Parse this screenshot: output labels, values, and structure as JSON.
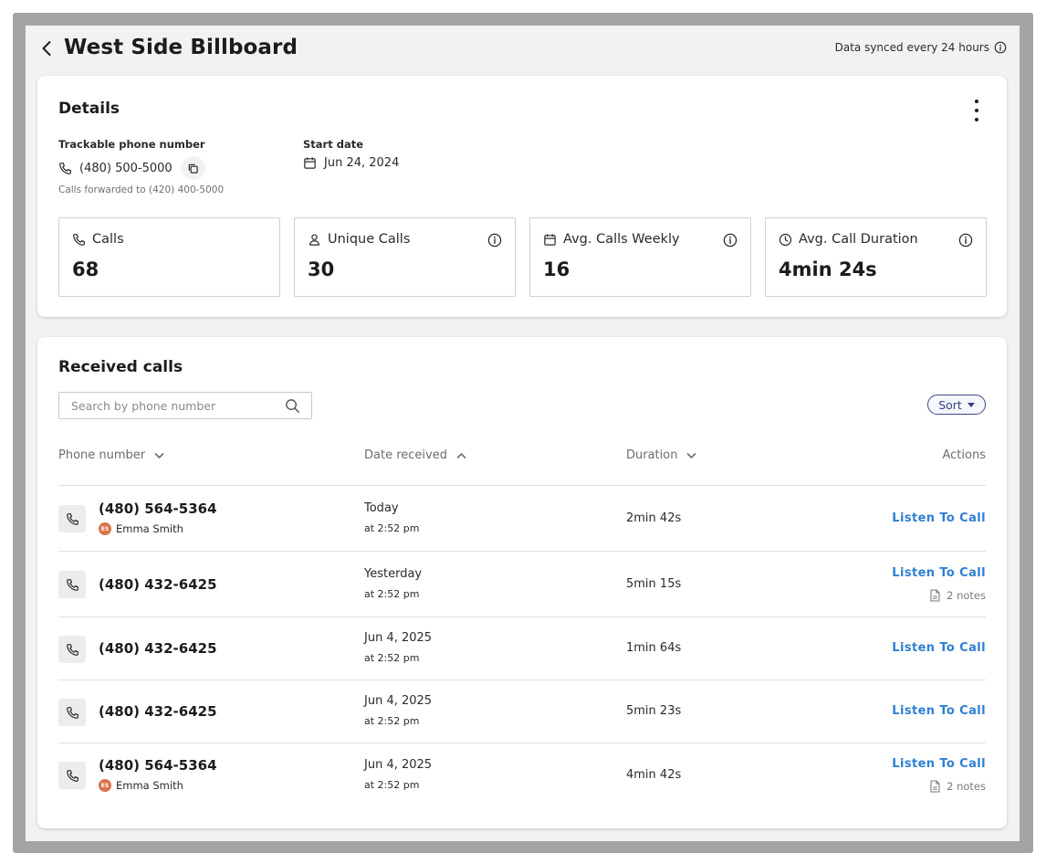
{
  "header": {
    "title": "West Side Billboard",
    "sync_text": "Data synced every 24 hours"
  },
  "details": {
    "title": "Details",
    "phone_label": "Trackable phone number",
    "phone_value": "(480) 500-5000",
    "forward_note": "Calls forwarded to (420) 400-5000",
    "start_label": "Start date",
    "start_value": "Jun 24, 2024",
    "stats": [
      {
        "label": "Calls",
        "value": "68",
        "icon": "phone-icon"
      },
      {
        "label": "Unique Calls",
        "value": "30",
        "icon": "person-icon"
      },
      {
        "label": "Avg. Calls Weekly",
        "value": "16",
        "icon": "calendar-icon"
      },
      {
        "label": "Avg. Call Duration",
        "value": "4min 24s",
        "icon": "clock-icon"
      }
    ]
  },
  "received": {
    "title": "Received calls",
    "search_placeholder": "Search by phone number",
    "sort_label": "Sort",
    "columns": {
      "phone": "Phone number",
      "date": "Date received",
      "duration": "Duration",
      "actions": "Actions"
    },
    "rows": [
      {
        "phone": "(480) 564-5364",
        "caller": "Emma Smith",
        "caller_initials": "ES",
        "date": "Today",
        "time": "at 2:52 pm",
        "duration": "2min 42s",
        "action": "Listen To Call",
        "notes": ""
      },
      {
        "phone": "(480) 432-6425",
        "caller": "",
        "caller_initials": "",
        "date": "Yesterday",
        "time": "at 2:52 pm",
        "duration": "5min 15s",
        "action": "Listen To Call",
        "notes": "2 notes"
      },
      {
        "phone": "(480) 432-6425",
        "caller": "",
        "caller_initials": "",
        "date": "Jun 4, 2025",
        "time": "at 2:52 pm",
        "duration": "1min 64s",
        "action": "Listen To Call",
        "notes": ""
      },
      {
        "phone": "(480) 432-6425",
        "caller": "",
        "caller_initials": "",
        "date": "Jun 4, 2025",
        "time": "at 2:52 pm",
        "duration": "5min 23s",
        "action": "Listen To Call",
        "notes": ""
      },
      {
        "phone": "(480) 564-5364",
        "caller": "Emma Smith",
        "caller_initials": "ES",
        "date": "Jun 4, 2025",
        "time": "at 2:52 pm",
        "duration": "4min 42s",
        "action": "Listen To Call",
        "notes": "2 notes"
      }
    ]
  },
  "colors": {
    "accent_link": "#2f7fd3",
    "sort_border": "#3a4a8a",
    "avatar_bg": "#d9734b",
    "page_bg": "#f2f2f2"
  }
}
